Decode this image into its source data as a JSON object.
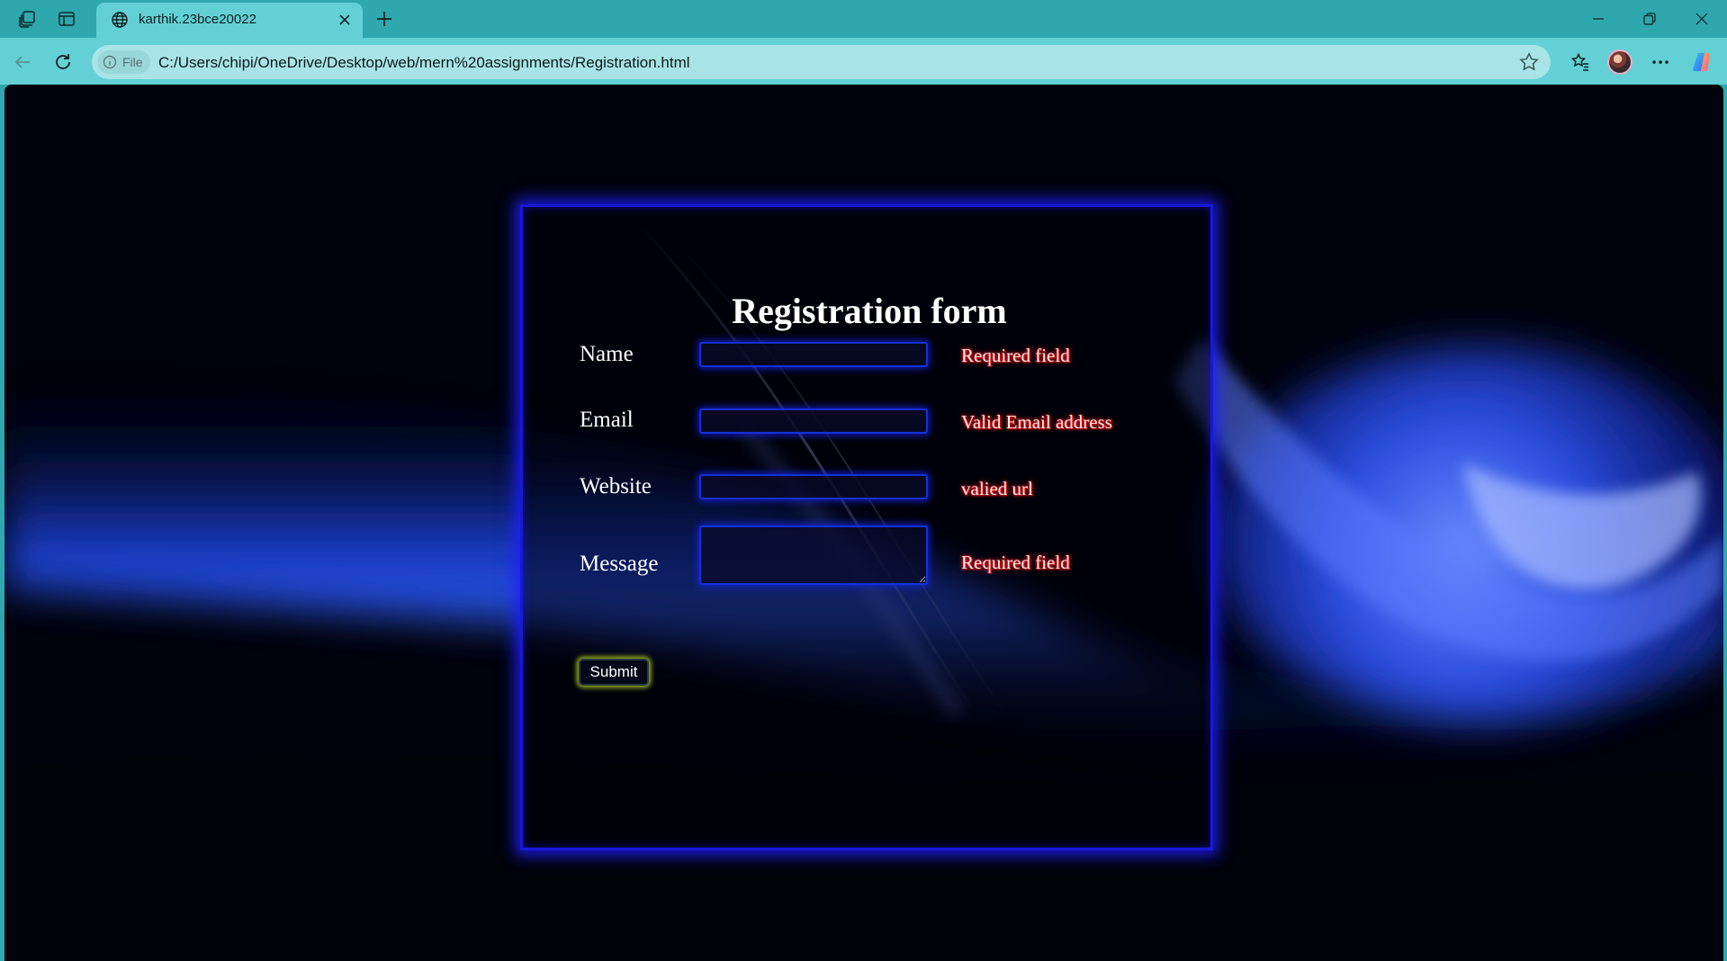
{
  "browser": {
    "tab_title": "karthik.23bce20022",
    "address_chip": "File",
    "url": "C:/Users/chipi/OneDrive/Desktop/web/mern%20assignments/Registration.html"
  },
  "form": {
    "title": "Registration form",
    "fields": [
      {
        "label": "Name",
        "value": "",
        "hint": "Required field"
      },
      {
        "label": "Email",
        "value": "",
        "hint": "Valid Email address"
      },
      {
        "label": "Website",
        "value": "",
        "hint": "valied url"
      },
      {
        "label": "Message",
        "value": "",
        "hint": "Required field"
      }
    ],
    "submit_label": "Submit"
  },
  "colors": {
    "chrome_dark": "#2ea7ad",
    "chrome_light": "#62d0d4",
    "card_border": "#1818d8",
    "hint_glow": "#ff2020",
    "submit_glow": "#c8e628"
  },
  "icons": {
    "workspaces": "workspaces-icon",
    "tab_actions": "tab-actions-icon",
    "favicon": "globe-icon",
    "close_tab": "close-icon",
    "new_tab": "plus-icon",
    "back": "back-arrow-icon",
    "refresh": "refresh-icon",
    "info": "info-icon",
    "favorite": "star-icon",
    "favorites": "favorites-list-icon",
    "more": "more-icon",
    "copilot": "copilot-icon"
  }
}
